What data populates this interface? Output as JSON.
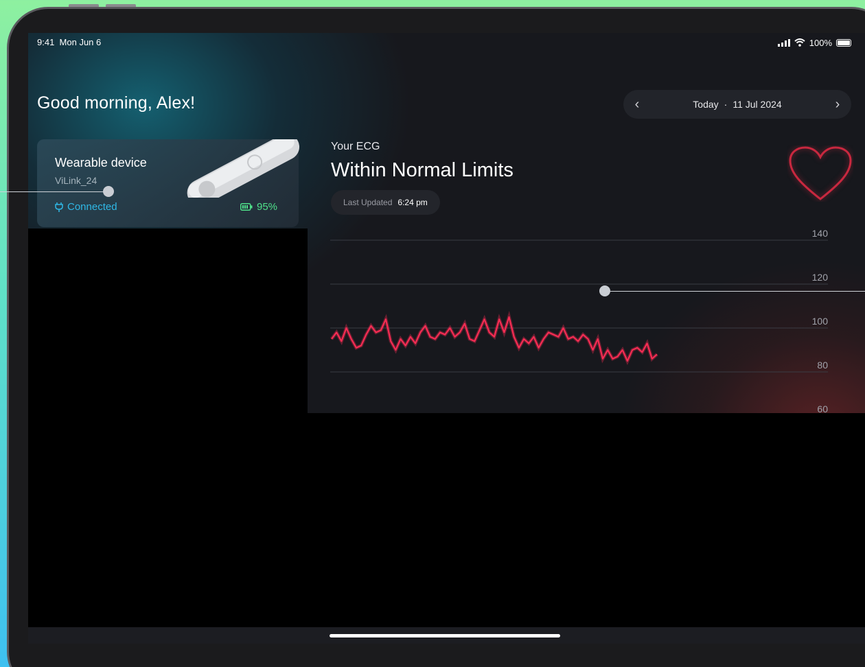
{
  "status": {
    "time": "9:41",
    "date": "Mon Jun 6",
    "battery": "100%"
  },
  "greeting": "Good morning, Alex!",
  "date_nav": {
    "prev_icon": "chevron-left-icon",
    "next_icon": "chevron-right-icon",
    "day": "Today",
    "separator": "·",
    "date": "11 Jul 2024"
  },
  "device": {
    "title": "Wearable device",
    "name": "ViLink_24",
    "status": "Connected",
    "battery": "95%"
  },
  "ecg": {
    "label": "Your ECG",
    "status": "Within Normal Limits",
    "updated_label": "Last Updated",
    "updated_value": "6:24 pm"
  },
  "colors": {
    "accent_teal": "#2fb8e6",
    "battery_green": "#4fe08a",
    "ecg_red": "#ff2d55",
    "heart_red": "#c8283f"
  },
  "chart_data": {
    "type": "line",
    "yticks": [
      "140",
      "120",
      "100",
      "80",
      "60"
    ],
    "ylim": [
      60,
      140
    ],
    "grid": true,
    "series": [
      {
        "values": [
          95,
          98,
          94,
          100,
          95,
          91,
          92,
          97,
          101,
          98,
          99,
          104,
          94,
          90,
          95,
          92,
          96,
          93,
          98,
          101,
          96,
          95,
          98,
          97,
          100,
          96,
          98,
          102,
          95,
          94,
          99,
          104,
          98,
          96,
          104,
          98,
          105,
          96,
          91,
          95,
          93,
          96,
          91,
          95,
          98,
          97,
          96,
          100,
          95,
          96,
          94,
          97,
          95,
          90,
          95,
          86,
          90,
          86,
          87,
          90,
          85,
          90,
          91,
          89,
          93,
          86,
          88
        ]
      }
    ]
  }
}
